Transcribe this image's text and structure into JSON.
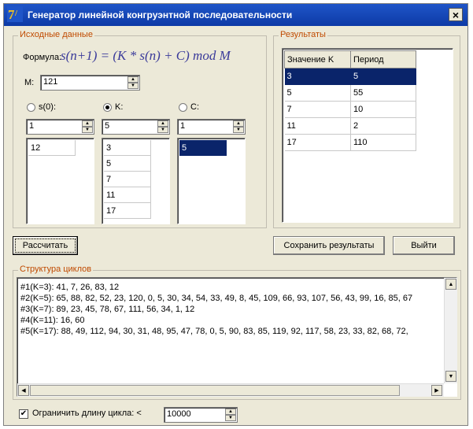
{
  "window": {
    "title": "Генератор линейной конгруэнтной последовательности",
    "close_glyph": "×"
  },
  "input": {
    "group_title": "Исходные данные",
    "formula_label": "Формула:",
    "formula": "s(n+1) = (K * s(n) + C) mod M",
    "m_label": "M:",
    "m_value": "121",
    "s0_label": "s(0):",
    "k_label": "K:",
    "c_label": "C:",
    "selected_param": "K",
    "s0_spin": "1",
    "k_spin": "5",
    "c_spin": "1",
    "s0_list": [
      "12"
    ],
    "k_list": [
      "3",
      "5",
      "7",
      "11",
      "17"
    ],
    "c_list": [
      "5"
    ]
  },
  "results": {
    "group_title": "Результаты",
    "columns": [
      "Значение K",
      "Период"
    ],
    "rows": [
      [
        "3",
        "5"
      ],
      [
        "5",
        "55"
      ],
      [
        "7",
        "10"
      ],
      [
        "11",
        "2"
      ],
      [
        "17",
        "110"
      ]
    ],
    "selected_row": 0
  },
  "buttons": {
    "calculate": "Рассчитать",
    "save": "Сохранить результаты",
    "exit": "Выйти"
  },
  "cycles": {
    "group_title": "Структура циклов",
    "lines": [
      "#1(K=3): 41, 7, 26, 83, 12",
      "#2(K=5): 65, 88, 82, 52, 23, 120, 0, 5, 30, 34, 54, 33, 49, 8, 45, 109, 66, 93, 107, 56, 43, 99, 16, 85, 67",
      "#3(K=7): 89, 23, 45, 78, 67, 111, 56, 34, 1, 12",
      "#4(K=11): 16, 60",
      "#5(K=17): 88, 49, 112, 94, 30, 31, 48, 95, 47, 78, 0, 5, 90, 83, 85, 119, 92, 117, 58, 23, 33, 82, 68, 72,"
    ]
  },
  "limit": {
    "checked": true,
    "label": "Ограничить длину цикла: <",
    "value": "10000"
  },
  "colors": {
    "titlebar": "#1f55c8",
    "selection": "#0a246a",
    "group_label": "#c04a00",
    "window_bg": "#ece9d8",
    "formula": "#3a3a9a"
  }
}
